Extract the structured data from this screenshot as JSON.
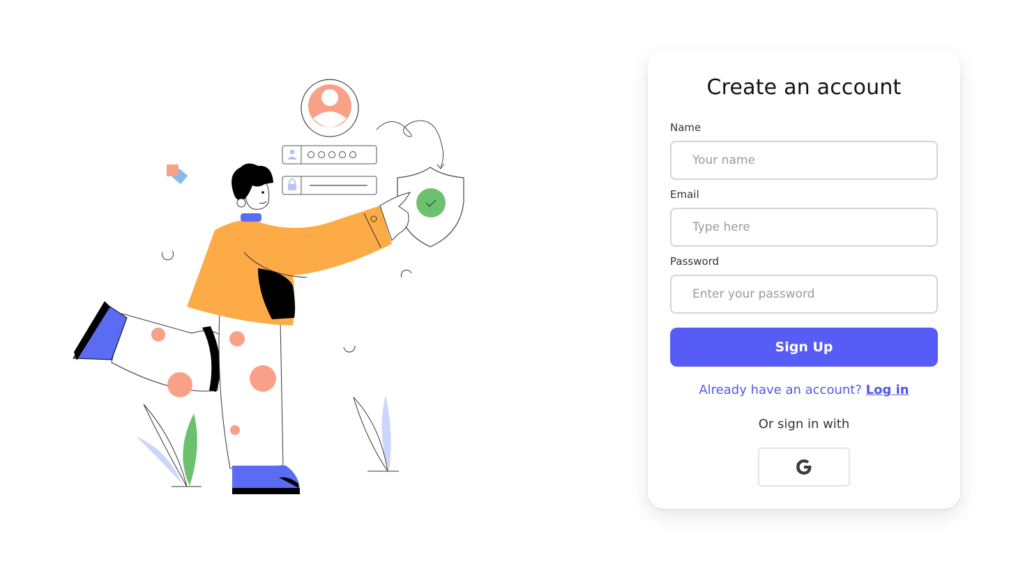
{
  "signup": {
    "title": "Create an account",
    "name_label": "Name",
    "name_placeholder": "Your name",
    "email_label": "Email",
    "email_placeholder": "Type here",
    "password_label": "Password",
    "password_placeholder": "Enter your password",
    "signup_button": "Sign Up",
    "login_prompt": "Already have an account?",
    "login_link": "Log in",
    "or_text": "Or sign in with",
    "social_icon": "google-icon"
  },
  "illustration": {
    "icons": [
      "user-avatar-icon",
      "user-icon",
      "lock-icon",
      "shield-check-icon"
    ],
    "colors": {
      "accent_orange": "#fdab46",
      "accent_salmon": "#f9a089",
      "accent_blue": "#5b6cf2",
      "accent_green": "#6cc16f",
      "light_blue": "#ccd6fb"
    }
  },
  "colors": {
    "primary": "#575cf7",
    "link": "#5258e5",
    "field_border": "#d4d4d4",
    "card_bg": "#ffffff"
  }
}
